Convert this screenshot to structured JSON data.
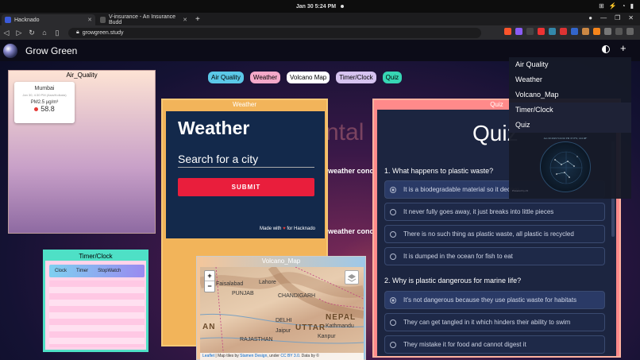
{
  "os": {
    "clock": "Jan 30  5:24 PM",
    "tray": [
      "⊞",
      "⚡",
      "◔",
      "▮"
    ]
  },
  "browser": {
    "tabs": [
      {
        "title": "Hacknado",
        "active": true
      },
      {
        "title": "V-insurance - An Insurance Budd",
        "active": false
      }
    ],
    "new_tab": "+",
    "url": "growgreen.study",
    "window_controls": [
      "●",
      "—",
      "❐",
      "✕"
    ]
  },
  "app": {
    "brand": "Grow Green",
    "nav_pills": [
      {
        "label": "Air Quality",
        "color": "#5bc8e8"
      },
      {
        "label": "Weather",
        "color": "#f5a9c9"
      },
      {
        "label": "Volcano Map",
        "color": "#ffffff"
      },
      {
        "label": "Timer/Clock",
        "color": "#d6c3f0"
      },
      {
        "label": "Quiz",
        "color": "#37d6b4"
      }
    ],
    "menu": [
      "Air Quality",
      "Weather",
      "Volcano_Map",
      "Timer/Clock",
      "Quiz"
    ],
    "ghost_title": "ntal",
    "ghost_lines": [
      "weather conc",
      "weather conc"
    ]
  },
  "air_quality": {
    "title": "Air_Quality",
    "city": "Mumbai",
    "time": "Jan 30, 4:30 PM (Asia/Kolkata)",
    "metric_label": "PM2.5 µg/m³",
    "value": "58.8"
  },
  "weather": {
    "title": "Weather",
    "heading": "Weather",
    "search_placeholder": "Search for a city",
    "submit": "SUBMIT",
    "footer_prefix": "Made with",
    "footer_heart": "♥",
    "footer_suffix": "for Hacknado"
  },
  "timer": {
    "title": "Timer/Clock",
    "tabs": [
      "Clock",
      "Timer",
      "StopWatch"
    ]
  },
  "volcano": {
    "title": "Volcano_Map",
    "zoom_in": "+",
    "zoom_out": "−",
    "labels": [
      "Faisalabad",
      "Lahore",
      "PUNJAB",
      "CHANDIGARH",
      "DELHI",
      "Jaipur",
      "RAJASTHAN",
      "Kanpur",
      "Kathmandu",
      "NEPAL",
      "UTTAR",
      "AN"
    ],
    "attribution_leaflet": "Leaflet",
    "attribution_mid": " | Map tiles by ",
    "attribution_stamen": "Stamen Design",
    "attribution_under": ", under ",
    "attribution_cc": "CC BY 3.0",
    "attribution_tail": ". Data by ©"
  },
  "quiz": {
    "title": "Quiz",
    "heading": "Quiz",
    "questions": [
      {
        "text": "1. What happens to plastic waste?",
        "options": [
          {
            "text": "It is a biodegradable material so it decom",
            "selected": true
          },
          {
            "text": "It never fully goes away, it just breaks into little pieces",
            "selected": false
          },
          {
            "text": "There is no such thing as plastic waste, all plastic is recycled",
            "selected": false
          },
          {
            "text": "It is dumped in the ocean for fish to eat",
            "selected": false
          }
        ]
      },
      {
        "text": "2. Why is plastic dangerous for marine life?",
        "options": [
          {
            "text": "It's not dangerous because they use plastic waste for habitats",
            "selected": true
          },
          {
            "text": "They can get tangled in it which hinders their ability to swim",
            "selected": false
          },
          {
            "text": "They mistake it for food and cannot digest it",
            "selected": false
          }
        ]
      }
    ]
  },
  "star_map": {
    "caption": "Jan 30 2023 5:24:02 PM  37.8°N, 144.98°",
    "footer": "Powered by d3"
  }
}
